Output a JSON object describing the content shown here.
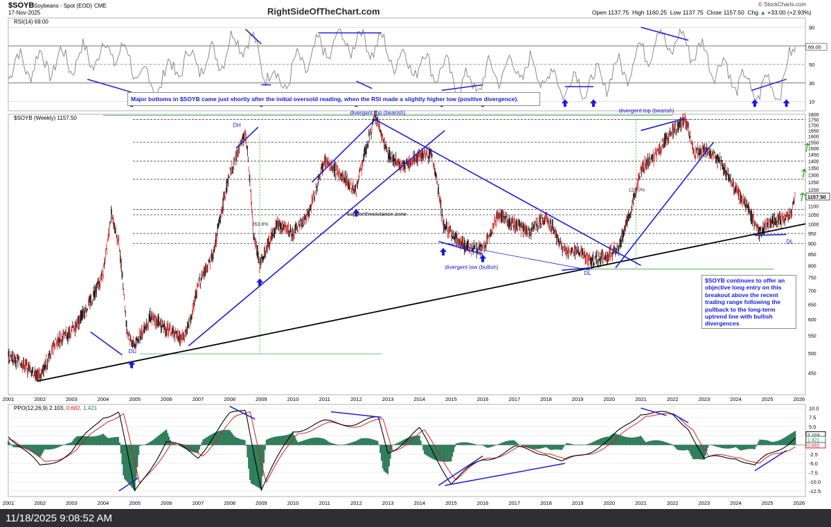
{
  "header": {
    "symbol": "$SOYB",
    "description": "Soybeans - Spot (EOD)",
    "exchange": "CME",
    "date": "17-Nov-2025",
    "site": "RightSideOfTheChart.com",
    "open_label": "Open",
    "open": "1137.75",
    "high_label": "High",
    "high": "1160.25",
    "low_label": "Low",
    "low": "1137.75",
    "close_label": "Close",
    "close": "1157.50",
    "chg_label": "Chg",
    "chg": "+33.00 (+2.93%)",
    "up_arrow": "▲",
    "credit": "© StockCharts.com"
  },
  "rsi_panel": {
    "legend": "RSI(14) 69.00",
    "levels": [
      "90",
      "70",
      "50",
      "30",
      "10"
    ],
    "current": "69.00",
    "note": "Major bottoms in $SOYB came just shortly after the initial oversold reading, when the RSI made a slightly higher low (positive divergence)."
  },
  "price_panel": {
    "legend": "$SOYB (Weekly) 1157.50",
    "price_tag": "1157.50",
    "annotations": {
      "dh": "DH",
      "divergent_top_1": "divergent top (bearish)",
      "divergent_top_2": "divergent top (bearish)",
      "support_resistance": "support/resistance zone",
      "divergent_low": "divergent low (bullish)",
      "dl_1": "DL",
      "dl_2": "DL",
      "dl_3": "DL",
      "pct_1": "263.8%",
      "pct_2": "124.0%"
    },
    "note": "$SOYB continues to offer an objective long entry on this breakout above the recent trading range following the pullback to the long-term uptrend line with bullish divergences"
  },
  "ppo_panel": {
    "legend_prefix": "PPO(12,26,9)",
    "ppo": "2.103",
    "signal": "0.682",
    "hist": "1.421",
    "tag_1": "2.103",
    "tag_2": "0.682",
    "tag_3": "1.421"
  },
  "taskbar": {
    "datetime": "11/18/2025 9:08:52 AM"
  },
  "colors": {
    "annotation_blue": "#1a1adc",
    "up_candle": "#000000",
    "down_candle": "#d42020",
    "rsi_line": "#8a8a8a",
    "ppo_line": "#000000",
    "signal_line": "#d42020",
    "histogram": "#2e7d5b",
    "target_arrow": "#22a022",
    "taskbar": "#2f2f33"
  },
  "chart_data": [
    {
      "type": "line",
      "name": "RSI(14)",
      "ylim": [
        0,
        100
      ],
      "y_ticks": [
        10,
        30,
        50,
        70,
        90
      ],
      "reference_lines": [
        70,
        30
      ],
      "x": [
        "2001",
        "2002",
        "2003",
        "2004",
        "2005",
        "2006",
        "2007",
        "2008",
        "2009",
        "2010",
        "2011",
        "2012",
        "2013",
        "2014",
        "2015",
        "2016",
        "2017",
        "2018",
        "2019",
        "2020",
        "2021",
        "2022",
        "2023",
        "2024",
        "2025",
        "2025-11"
      ],
      "values": [
        48,
        52,
        58,
        66,
        26,
        52,
        56,
        80,
        28,
        58,
        76,
        74,
        52,
        48,
        26,
        44,
        46,
        28,
        30,
        46,
        76,
        72,
        46,
        22,
        28,
        69
      ]
    },
    {
      "type": "line",
      "name": "$SOYB (Weekly)",
      "scale": "log",
      "ylim": [
        400,
        1800
      ],
      "y_ticks": [
        450,
        500,
        550,
        600,
        650,
        700,
        750,
        800,
        850,
        900,
        950,
        1000,
        1050,
        1100,
        1150,
        1200,
        1250,
        1300,
        1350,
        1400,
        1450,
        1500,
        1550,
        1600,
        1650,
        1700,
        1750,
        1800
      ],
      "x_ticks": [
        "2001",
        "2002",
        "2003",
        "2004",
        "2005",
        "2006",
        "2007",
        "2008",
        "2009",
        "2010",
        "2011",
        "2012",
        "2013",
        "2014",
        "2015",
        "2016",
        "2017",
        "2018",
        "2019",
        "2020",
        "2021",
        "2022",
        "2023",
        "2024",
        "2025",
        "2026"
      ],
      "x": [
        2001.0,
        2001.5,
        2002.0,
        2002.5,
        2003.0,
        2003.5,
        2004.0,
        2004.25,
        2004.5,
        2004.75,
        2005.0,
        2005.5,
        2006.0,
        2006.5,
        2006.75,
        2007.0,
        2007.5,
        2008.0,
        2008.5,
        2008.75,
        2008.95,
        2009.5,
        2010.0,
        2010.5,
        2011.0,
        2011.5,
        2012.0,
        2012.6,
        2013.0,
        2013.5,
        2014.0,
        2014.4,
        2014.75,
        2015.0,
        2015.5,
        2016.0,
        2016.5,
        2017.0,
        2017.5,
        2018.0,
        2018.4,
        2018.6,
        2019.0,
        2019.4,
        2019.9,
        2020.3,
        2020.7,
        2021.0,
        2021.5,
        2022.0,
        2022.4,
        2022.7,
        2023.0,
        2023.5,
        2024.0,
        2024.5,
        2024.75,
        2025.0,
        2025.5,
        2025.75,
        2025.88
      ],
      "values": [
        495,
        470,
        440,
        530,
        560,
        640,
        760,
        1050,
        900,
        560,
        520,
        610,
        570,
        540,
        590,
        720,
        860,
        1300,
        1620,
        950,
        800,
        1000,
        950,
        1050,
        1400,
        1300,
        1200,
        1780,
        1450,
        1350,
        1440,
        1450,
        1000,
        950,
        880,
        870,
        1050,
        1000,
        960,
        1040,
        920,
        860,
        870,
        820,
        840,
        880,
        1080,
        1350,
        1450,
        1650,
        1750,
        1450,
        1500,
        1400,
        1200,
        1050,
        950,
        1000,
        1030,
        1060,
        1157.5
      ]
    },
    {
      "type": "line",
      "name": "PPO(12,26,9)",
      "ylim": [
        -14,
        11
      ],
      "y_ticks": [
        10.0,
        7.5,
        5.0,
        2.5,
        -2.5,
        -5.0,
        -7.5,
        -10.0,
        -12.5
      ],
      "x": [
        2001,
        2002,
        2003,
        2004,
        2004.5,
        2005,
        2006,
        2007,
        2008,
        2008.5,
        2009,
        2010,
        2011,
        2012,
        2012.7,
        2013,
        2014,
        2015,
        2016,
        2017,
        2018,
        2018.5,
        2019,
        2020,
        2021,
        2022,
        2022.5,
        2023,
        2024,
        2024.6,
        2025,
        2025.88
      ],
      "series": [
        {
          "name": "PPO",
          "values": [
            3,
            -6,
            -2,
            8,
            9,
            -13,
            1,
            -3,
            8,
            10,
            -12,
            4,
            6,
            6,
            7,
            -2,
            4,
            -10,
            -4,
            -1,
            -2,
            -5,
            -3,
            1,
            9,
            8,
            5,
            -4,
            -3,
            -6,
            -3,
            2.103
          ]
        },
        {
          "name": "Signal",
          "values": [
            2,
            -5,
            -1.5,
            7,
            8.5,
            -11,
            0.5,
            -2.5,
            7,
            9.5,
            -10,
            3.5,
            5.5,
            5.5,
            6.5,
            -1.5,
            3.5,
            -9,
            -3.5,
            -1,
            -1.8,
            -4.5,
            -2.8,
            0.5,
            8.5,
            7.5,
            4.8,
            -3.5,
            -2.8,
            -5.5,
            -3,
            0.682
          ]
        },
        {
          "name": "Histogram",
          "values": [
            1,
            -1,
            -0.5,
            1,
            0.5,
            -2,
            0.5,
            -0.5,
            1,
            0.5,
            -2,
            0.5,
            0.5,
            0.5,
            0.5,
            -0.5,
            0.5,
            -1,
            -0.5,
            0,
            -0.2,
            -0.5,
            -0.2,
            0.5,
            0.5,
            0.5,
            0.2,
            -0.5,
            -0.2,
            -0.5,
            0,
            1.421
          ]
        }
      ]
    }
  ]
}
